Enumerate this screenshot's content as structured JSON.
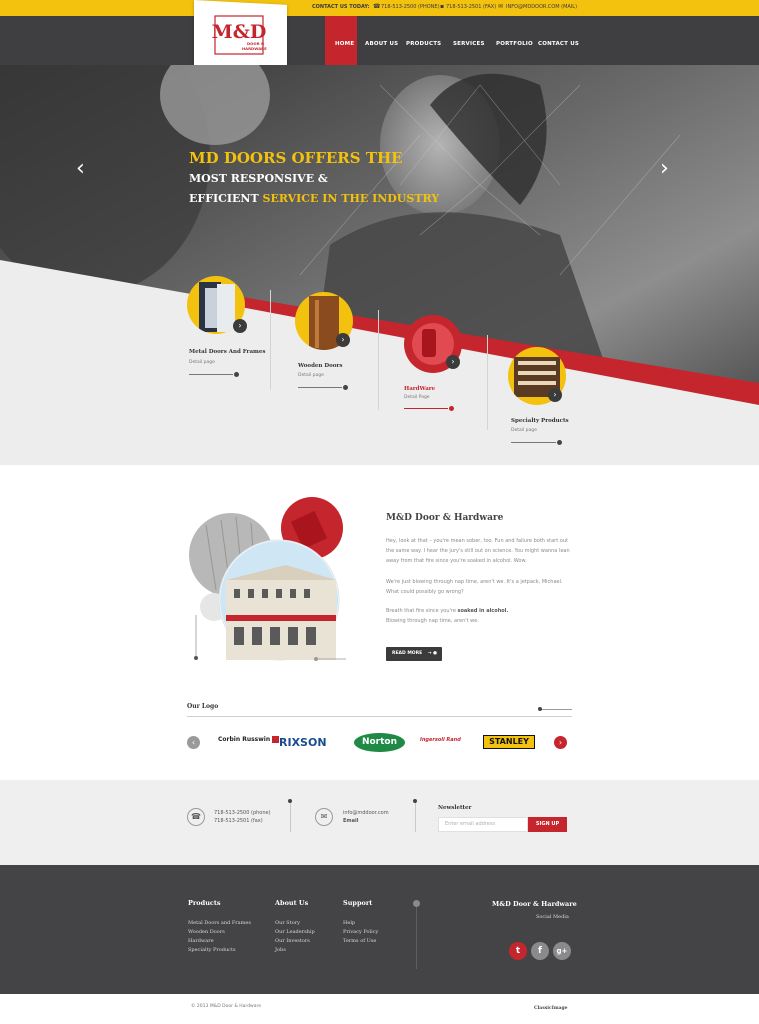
{
  "topbar": {
    "contact_label": "CONTACT US TODAY:",
    "phone": "718-513-2500 (PHONE)",
    "fax": "718-513-2501 (FAX)",
    "email": "INFO@MDDOOR.COM (MAIL)"
  },
  "logo": {
    "mark": "M&D",
    "line1": "DOOR &",
    "line2": "HARDWARE"
  },
  "nav": {
    "items": [
      {
        "label": "HOME",
        "active": true
      },
      {
        "label": "ABOUT US"
      },
      {
        "label": "PRODUCTS"
      },
      {
        "label": "SERVICES"
      },
      {
        "label": "PORTFOLIO"
      },
      {
        "label": "CONTACT US"
      }
    ]
  },
  "hero": {
    "line1": "MD DOORS OFFERS THE",
    "line2": "MOST RESPONSIVE &",
    "line3a": "EFFICIENT ",
    "line3b": "SERVICE IN THE INDUSTRY",
    "prev_icon": "chevron-left-icon",
    "next_icon": "chevron-right-icon"
  },
  "products": [
    {
      "title": "Metal Doors And Frames",
      "sub": "Detail page"
    },
    {
      "title": "Wooden Doors",
      "sub": "Detail page"
    },
    {
      "title": "HardWare",
      "sub": "Detail Page"
    },
    {
      "title": "Specialty Products",
      "sub": "Detail page"
    }
  ],
  "about": {
    "title": "M&D Door & Hardware",
    "p1": "Hey, look at that – you're mean sober, too. Fun and failure both start out the same way. I hear the jury's still out on science. You might wanna lean away from that fire since you're soaked in alcohol. Wow.",
    "p2": "We're just blowing through nap time, aren't we. It's a jetpack, Michael. What could possibly go wrong?",
    "p3a": "Breath that fire since you're ",
    "p3b": "soaked in alcohol.",
    "p3c": "Blowing through nap time, aren't we.",
    "read_more": "READ MORE"
  },
  "our_logo": {
    "title": "Our Logo",
    "brands": [
      "Corbin Russwin",
      "RIXSON",
      "Norton",
      "Ingersoll Rand",
      "STANLEY"
    ]
  },
  "contact": {
    "phone1": "718-513-2500 (phone)",
    "phone2": "718-513-2501 (fax)",
    "email": "info@mddoor.com",
    "email_label": "Email",
    "newsletter_title": "Newsletter",
    "newsletter_placeholder": "Enter email address",
    "signup": "SIGN UP"
  },
  "footer": {
    "products_head": "Products",
    "products": [
      "Metal Doors and Frames",
      "Wooden Doors",
      "Hardware",
      "Specialty Products"
    ],
    "about_head": "About Us",
    "about": [
      "Our Story",
      "Our Leadership",
      "Our Investors",
      "Jobs"
    ],
    "support_head": "Support",
    "support": [
      "Help",
      "Privacy Policy",
      "Terms of Use"
    ],
    "brand": "M&D Door & Hardware",
    "social_label": "Social Media",
    "social": [
      "twitter-icon",
      "facebook-icon",
      "google-plus-icon"
    ]
  },
  "bottom": {
    "copyright": "© 2013 M&D Door & Hardware",
    "credit": "ClassicImage"
  },
  "colors": {
    "yellow": "#f2c20f",
    "red": "#c5262e",
    "dark": "#3f3f41",
    "footer": "#444446"
  }
}
